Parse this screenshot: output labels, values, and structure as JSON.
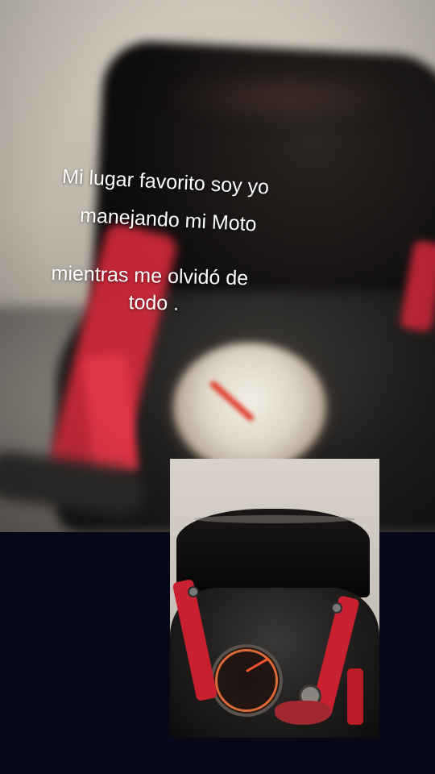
{
  "caption": {
    "line1": "Mi lugar favorito soy yo",
    "line2": "manejando mi Moto",
    "line3": "mientras me olvidó de",
    "line4": "todo ."
  }
}
